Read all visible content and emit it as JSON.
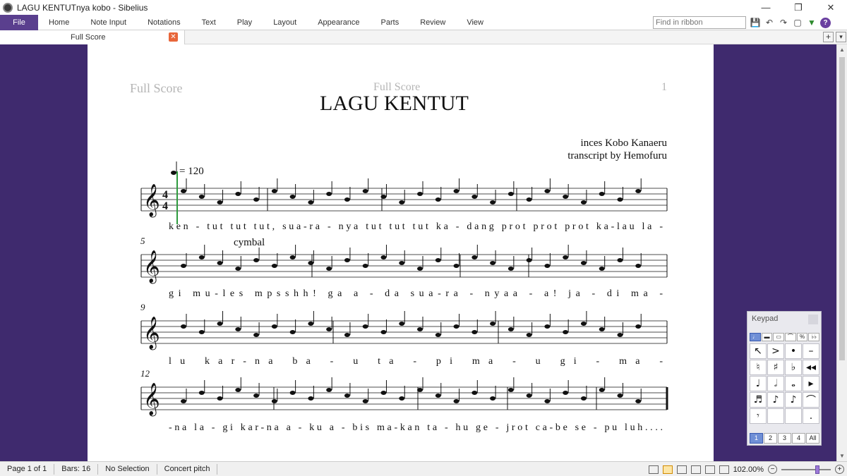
{
  "window": {
    "title": "LAGU KENTUTnya kobo - Sibelius",
    "controls": [
      "—",
      "❐",
      "✕"
    ]
  },
  "ribbon": {
    "tabs": [
      "File",
      "Home",
      "Note Input",
      "Notations",
      "Text",
      "Play",
      "Layout",
      "Appearance",
      "Parts",
      "Review",
      "View"
    ],
    "search_placeholder": "Find in ribbon",
    "tools": {
      "save": "💾",
      "undo": "↶",
      "redo": "↷",
      "restore": "▢",
      "expand": "▼",
      "help": "?"
    }
  },
  "doc_tabs": {
    "active": "Full Score",
    "close": "✕",
    "add": "+",
    "menu": "▾"
  },
  "score": {
    "header_left": "Full Score",
    "header_center": "Full Score",
    "page_number": "1",
    "title": "LAGU KENTUT",
    "composer": "inces Kobo Kanaeru",
    "transcriber": "transcript by Hemofuru",
    "tempo": "= 120",
    "systems": [
      {
        "bar_number": "",
        "lyrics": [
          "ken",
          "-",
          "tut",
          "tut",
          "tut,",
          "sua-ra",
          "-",
          "nya",
          "tut",
          "tut",
          "tut",
          "ka",
          "-",
          "dang",
          "prot",
          "prot",
          "prot",
          "ka-lau",
          "la",
          "-"
        ]
      },
      {
        "bar_number": "5",
        "technique": "cymbal",
        "lyrics": [
          "gi",
          "mu-les",
          "mpsshh!",
          "ga",
          "a",
          "-",
          "da",
          "sua-ra",
          "-",
          "nyaa",
          "-",
          "a!",
          "ja",
          "-",
          "di",
          "ma",
          "-"
        ]
      },
      {
        "bar_number": "9",
        "lyrics": [
          "lu",
          "kar-na",
          "ba",
          "-",
          "u",
          "ta",
          "-",
          "pi",
          "ma",
          "-",
          "u",
          "gi",
          "-",
          "ma",
          "-"
        ]
      },
      {
        "bar_number": "12",
        "lyrics": [
          "-na",
          "la",
          "-",
          "gi",
          "kar-na",
          "a",
          "-",
          "ku",
          "a",
          "-",
          "bis",
          "ma-kan",
          "ta",
          "-",
          "hu",
          "ge",
          "-",
          "jrot",
          "ca-be",
          "se",
          "-",
          "pu",
          "luh...."
        ]
      }
    ]
  },
  "status": {
    "page": "Page 1 of 1",
    "bars": "Bars: 16",
    "selection": "No Selection",
    "pitch": "Concert pitch",
    "zoom": "102.00%"
  },
  "keypad": {
    "title": "Keypad",
    "modes": [
      "♩",
      "▬",
      "▭",
      "⌒",
      "%",
      "♭♭"
    ],
    "keys": [
      "↖",
      ">",
      "•",
      "–",
      "♮",
      "♯",
      "♭",
      "◂◂",
      "♩",
      "𝅗𝅥",
      "𝅝",
      "▸",
      "♬",
      "♪",
      "♪",
      "⌒",
      "𝄾",
      "",
      "",
      "."
    ],
    "layouts": [
      "1",
      "2",
      "3",
      "4",
      "All"
    ]
  }
}
